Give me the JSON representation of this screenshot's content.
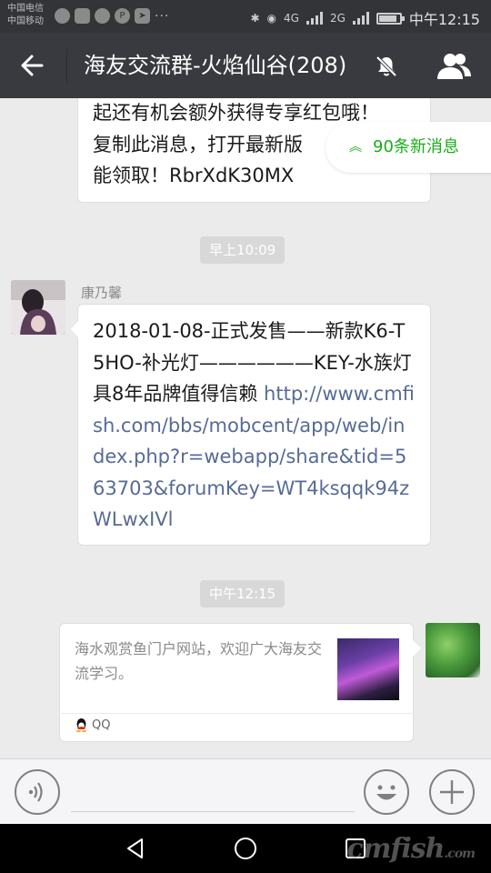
{
  "statusbar": {
    "carrier_1": "中国电信",
    "carrier_2": "中国移动",
    "network_1": "4G",
    "network_2": "2G",
    "time": "中午12:15",
    "battery_level": 0.85,
    "more": "···"
  },
  "header": {
    "title": "海友交流群-火焰仙谷(208)"
  },
  "messages": {
    "m1_lines": [
      "起还有机会额外获得专享红包哦！",
      "复制此消息，打开最新版",
      "能领取！RbrXdK30MX"
    ],
    "new_messages": "90条新消息",
    "time_1": "早上10:09",
    "sender": "康乃馨",
    "m2_text": "2018-01-08-正式发售——新款K6-T5HO-补光灯——————KEY-水族灯具8年品牌值得信赖 ",
    "m2_link": "http://www.cmfish.com/bbs/mobcent/app/web/index.php?r=webapp/share&tid=563703&forumKey=WT4ksqqk94zWLwxIVl",
    "time_2": "中午12:15",
    "card_text": "海水观赏鱼门户网站，欢迎广大海友交流学习。",
    "card_source": "QQ"
  },
  "watermark": {
    "text": "cmfish",
    "suffix": ".com"
  }
}
